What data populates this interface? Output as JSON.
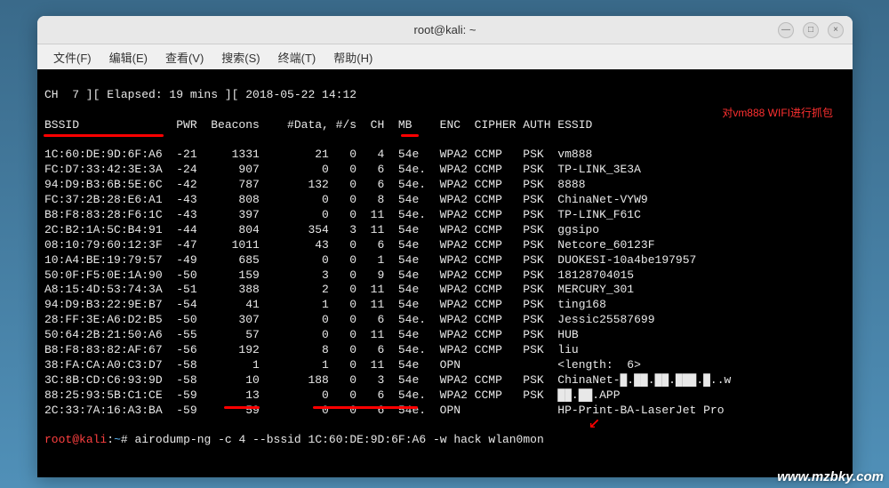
{
  "window": {
    "title": "root@kali: ~",
    "controls": {
      "min": "—",
      "max": "□",
      "close": "×"
    }
  },
  "menu": {
    "file": "文件(F)",
    "edit": "编辑(E)",
    "view": "查看(V)",
    "search": "搜索(S)",
    "terminal": "终端(T)",
    "help": "帮助(H)"
  },
  "status_line": "CH  7 ][ Elapsed: 19 mins ][ 2018-05-22 14:12",
  "headers": {
    "bssid": "BSSID",
    "pwr": "PWR",
    "beacons": "Beacons",
    "data": "#Data,",
    "ps": "#/s",
    "ch": "CH",
    "mb": "MB",
    "enc": "ENC",
    "cipher": "CIPHER",
    "auth": "AUTH",
    "essid": "ESSID"
  },
  "annotation": "对vm888 WIFI进行抓包",
  "rows": [
    {
      "bssid": "1C:60:DE:9D:6F:A6",
      "pwr": "-21",
      "beacons": "1331",
      "data": "21",
      "ps": "0",
      "ch": "4",
      "mb": "54e",
      "enc": "WPA2",
      "cipher": "CCMP",
      "auth": "PSK",
      "essid": "vm888"
    },
    {
      "bssid": "FC:D7:33:42:3E:3A",
      "pwr": "-24",
      "beacons": "907",
      "data": "0",
      "ps": "0",
      "ch": "6",
      "mb": "54e.",
      "enc": "WPA2",
      "cipher": "CCMP",
      "auth": "PSK",
      "essid": "TP-LINK_3E3A"
    },
    {
      "bssid": "94:D9:B3:6B:5E:6C",
      "pwr": "-42",
      "beacons": "787",
      "data": "132",
      "ps": "0",
      "ch": "6",
      "mb": "54e.",
      "enc": "WPA2",
      "cipher": "CCMP",
      "auth": "PSK",
      "essid": "8888"
    },
    {
      "bssid": "FC:37:2B:28:E6:A1",
      "pwr": "-43",
      "beacons": "808",
      "data": "0",
      "ps": "0",
      "ch": "8",
      "mb": "54e",
      "enc": "WPA2",
      "cipher": "CCMP",
      "auth": "PSK",
      "essid": "ChinaNet-VYW9"
    },
    {
      "bssid": "B8:F8:83:28:F6:1C",
      "pwr": "-43",
      "beacons": "397",
      "data": "0",
      "ps": "0",
      "ch": "11",
      "mb": "54e.",
      "enc": "WPA2",
      "cipher": "CCMP",
      "auth": "PSK",
      "essid": "TP-LINK_F61C"
    },
    {
      "bssid": "2C:B2:1A:5C:B4:91",
      "pwr": "-44",
      "beacons": "804",
      "data": "354",
      "ps": "3",
      "ch": "11",
      "mb": "54e",
      "enc": "WPA2",
      "cipher": "CCMP",
      "auth": "PSK",
      "essid": "ggsipo"
    },
    {
      "bssid": "08:10:79:60:12:3F",
      "pwr": "-47",
      "beacons": "1011",
      "data": "43",
      "ps": "0",
      "ch": "6",
      "mb": "54e",
      "enc": "WPA2",
      "cipher": "CCMP",
      "auth": "PSK",
      "essid": "Netcore_60123F"
    },
    {
      "bssid": "10:A4:BE:19:79:57",
      "pwr": "-49",
      "beacons": "685",
      "data": "0",
      "ps": "0",
      "ch": "1",
      "mb": "54e",
      "enc": "WPA2",
      "cipher": "CCMP",
      "auth": "PSK",
      "essid": "DUOKESI-10a4be197957"
    },
    {
      "bssid": "50:0F:F5:0E:1A:90",
      "pwr": "-50",
      "beacons": "159",
      "data": "3",
      "ps": "0",
      "ch": "9",
      "mb": "54e",
      "enc": "WPA2",
      "cipher": "CCMP",
      "auth": "PSK",
      "essid": "18128704015"
    },
    {
      "bssid": "A8:15:4D:53:74:3A",
      "pwr": "-51",
      "beacons": "388",
      "data": "2",
      "ps": "0",
      "ch": "11",
      "mb": "54e",
      "enc": "WPA2",
      "cipher": "CCMP",
      "auth": "PSK",
      "essid": "MERCURY_301"
    },
    {
      "bssid": "94:D9:B3:22:9E:B7",
      "pwr": "-54",
      "beacons": "41",
      "data": "1",
      "ps": "0",
      "ch": "11",
      "mb": "54e",
      "enc": "WPA2",
      "cipher": "CCMP",
      "auth": "PSK",
      "essid": "ting168"
    },
    {
      "bssid": "28:FF:3E:A6:D2:B5",
      "pwr": "-50",
      "beacons": "307",
      "data": "0",
      "ps": "0",
      "ch": "6",
      "mb": "54e.",
      "enc": "WPA2",
      "cipher": "CCMP",
      "auth": "PSK",
      "essid": "Jessic25587699"
    },
    {
      "bssid": "50:64:2B:21:50:A6",
      "pwr": "-55",
      "beacons": "57",
      "data": "0",
      "ps": "0",
      "ch": "11",
      "mb": "54e",
      "enc": "WPA2",
      "cipher": "CCMP",
      "auth": "PSK",
      "essid": "HUB"
    },
    {
      "bssid": "B8:F8:83:82:AF:67",
      "pwr": "-56",
      "beacons": "192",
      "data": "8",
      "ps": "0",
      "ch": "6",
      "mb": "54e.",
      "enc": "WPA2",
      "cipher": "CCMP",
      "auth": "PSK",
      "essid": "liu"
    },
    {
      "bssid": "38:FA:CA:A0:C3:D7",
      "pwr": "-58",
      "beacons": "1",
      "data": "1",
      "ps": "0",
      "ch": "11",
      "mb": "54e",
      "enc": "OPN",
      "cipher": "",
      "auth": "",
      "essid": "<length:  6>"
    },
    {
      "bssid": "3C:8B:CD:C6:93:9D",
      "pwr": "-58",
      "beacons": "10",
      "data": "188",
      "ps": "0",
      "ch": "3",
      "mb": "54e",
      "enc": "WPA2",
      "cipher": "CCMP",
      "auth": "PSK",
      "essid": "ChinaNet-█.██.██.███.█..w"
    },
    {
      "bssid": "88:25:93:5B:C1:CE",
      "pwr": "-59",
      "beacons": "13",
      "data": "0",
      "ps": "0",
      "ch": "6",
      "mb": "54e.",
      "enc": "WPA2",
      "cipher": "CCMP",
      "auth": "PSK",
      "essid": "██.██.APP"
    },
    {
      "bssid": "2C:33:7A:16:A3:BA",
      "pwr": "-59",
      "beacons": "59",
      "data": "0",
      "ps": "0",
      "ch": "6",
      "mb": "54e.",
      "enc": "OPN",
      "cipher": "",
      "auth": "",
      "essid": "HP-Print-BA-LaserJet Pro"
    }
  ],
  "prompt": {
    "user": "root",
    "at": "@",
    "host": "kali",
    "sep": ":",
    "tilde": "~",
    "hash": "#",
    "cmd": " airodump-ng -c 4 --bssid 1C:60:DE:9D:6F:A6 -w hack wlan0mon"
  },
  "watermark": "www.mzbky.com"
}
